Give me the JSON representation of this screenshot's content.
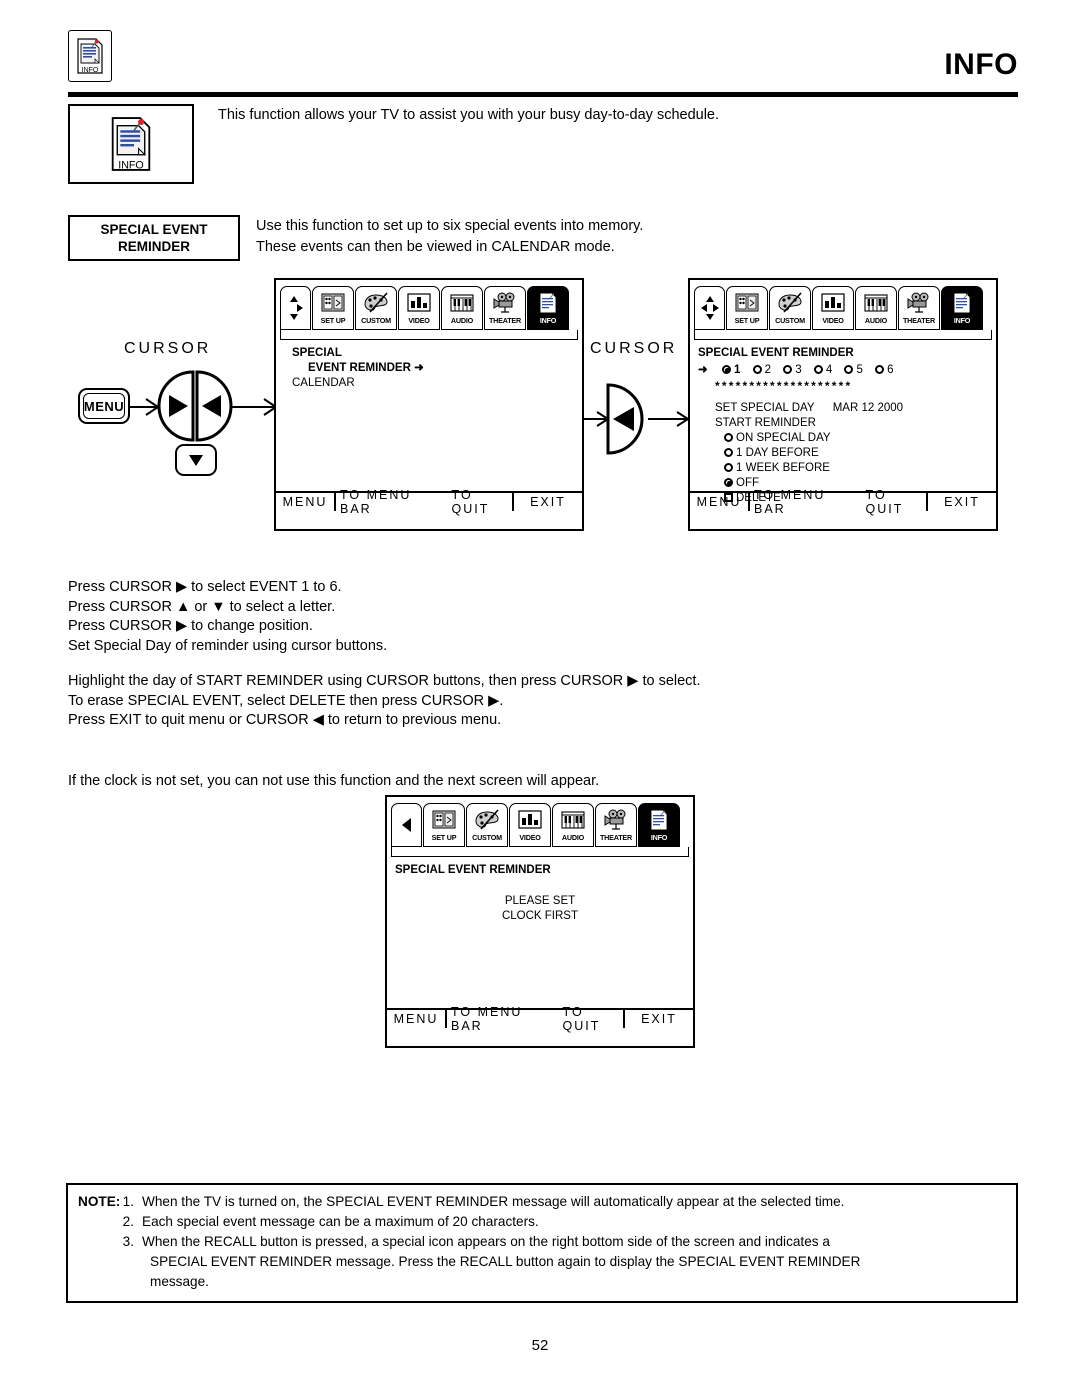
{
  "header": {
    "title": "INFO",
    "icon_name": "info-document-icon",
    "icon_caption": "INFO"
  },
  "intro": {
    "icon_caption": "INFO",
    "text": "This function allows your TV to assist you with your busy day-to-day schedule."
  },
  "feature": {
    "label_line1": "SPECIAL EVENT",
    "label_line2": "REMINDER",
    "desc_line1": "Use this function to set up to six special events into memory.",
    "desc_line2": "These events can then be viewed in CALENDAR mode."
  },
  "cursor_diagram": {
    "label_left": "CURSOR",
    "label_middle": "CURSOR",
    "menu_button": "MENU",
    "left_arrow": "◀",
    "right_arrow": "▶",
    "down_arrow": "▼",
    "up_arrow": "▲"
  },
  "menu_bar": {
    "items": [
      {
        "caption": "SET UP",
        "icon_name": "setup-icon"
      },
      {
        "caption": "CUSTOM",
        "icon_name": "palette-icon"
      },
      {
        "caption": "VIDEO",
        "icon_name": "video-bars-icon"
      },
      {
        "caption": "AUDIO",
        "icon_name": "piano-keys-icon"
      },
      {
        "caption": "THEATER",
        "icon_name": "film-projector-icon"
      },
      {
        "caption": "INFO",
        "icon_name": "info-document-icon"
      }
    ],
    "selected": "INFO"
  },
  "tv_footer": {
    "menu": "MENU",
    "to_menu_bar": "TO MENU BAR",
    "to_quit": "TO QUIT",
    "exit": "EXIT"
  },
  "screen_left": {
    "navpad_name": "up-right-down-nav-pad",
    "rows": [
      {
        "text": "SPECIAL",
        "bold": true,
        "indent": false
      },
      {
        "text": "EVENT REMINDER",
        "bold": true,
        "indent": true,
        "arrow": "➜"
      },
      {
        "text": "CALENDAR",
        "bold": false,
        "indent": false
      }
    ]
  },
  "screen_right": {
    "navpad_name": "four-way-nav-pad",
    "title": "SPECIAL EVENT REMINDER",
    "pointer": "➜",
    "events": [
      {
        "label": "1",
        "selected": true
      },
      {
        "label": "2",
        "selected": false
      },
      {
        "label": "3",
        "selected": false
      },
      {
        "label": "4",
        "selected": false
      },
      {
        "label": "5",
        "selected": false
      },
      {
        "label": "6",
        "selected": false
      }
    ],
    "message_chars": "********************",
    "set_special_day_label": "SET SPECIAL DAY",
    "set_special_day_value": "MAR 12  2000",
    "start_reminder_label": "START REMINDER",
    "options": [
      {
        "label": "ON SPECIAL DAY",
        "type": "radio",
        "selected": false
      },
      {
        "label": "1 DAY BEFORE",
        "type": "radio",
        "selected": false
      },
      {
        "label": "1 WEEK BEFORE",
        "type": "radio",
        "selected": false
      },
      {
        "label": "OFF",
        "type": "radio",
        "selected": true
      },
      {
        "label": "DELETE",
        "type": "checkbox",
        "selected": false
      }
    ]
  },
  "screen_bottom": {
    "navpad_name": "left-nav-pad",
    "title": "SPECIAL EVENT REMINDER",
    "message_line1": "PLEASE SET",
    "message_line2": "CLOCK FIRST"
  },
  "instructions": {
    "group1": [
      "Press CURSOR ▶ to select EVENT 1 to 6.",
      "Press CURSOR ▲ or ▼ to select a letter.",
      "Press CURSOR ▶ to change position.",
      "Set Special Day of reminder using cursor buttons."
    ],
    "group2": [
      "Highlight the day of START REMINDER using CURSOR buttons, then press CURSOR ▶ to select.",
      "To erase SPECIAL EVENT, select DELETE then press CURSOR ▶.",
      "Press EXIT to quit menu or CURSOR ◀ to return to previous menu."
    ],
    "group3": [
      "If the clock is not set, you can not use this function and the next screen will appear."
    ]
  },
  "note": {
    "label": "NOTE:",
    "items": [
      {
        "num": "1.",
        "lines": [
          "When the TV is turned on, the SPECIAL EVENT REMINDER message will automatically appear at the selected time."
        ]
      },
      {
        "num": "2.",
        "lines": [
          "Each special event message can be a maximum of 20 characters."
        ]
      },
      {
        "num": "3.",
        "lines": [
          "When the RECALL button is pressed, a special icon appears on the right bottom side of the screen and indicates a",
          "SPECIAL EVENT REMINDER message. Press the RECALL button again to display the SPECIAL EVENT REMINDER",
          "message."
        ]
      }
    ]
  },
  "page_number": "52",
  "colors": {
    "ink": "#000000",
    "paper": "#ffffff",
    "doc_blue": "#2d4fa8",
    "pin_red": "#e02028"
  }
}
